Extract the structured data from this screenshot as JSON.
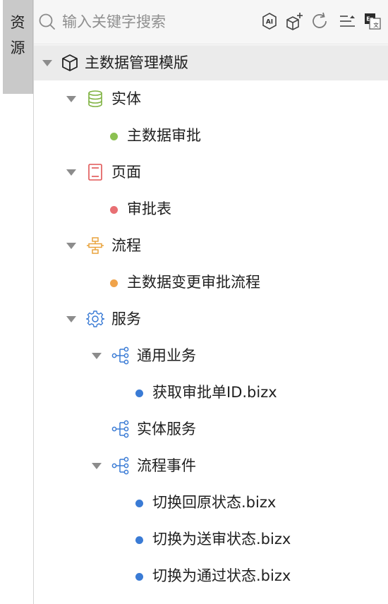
{
  "sidebar": {
    "tab_label_line1": "资",
    "tab_label_line2": "源"
  },
  "search": {
    "placeholder": "输入关键字搜索",
    "value": ""
  },
  "toolbar": {
    "ai_label": "AI",
    "lang_label_en": "En",
    "lang_label_zh": "文"
  },
  "tree": {
    "root": {
      "label": "主数据管理模版",
      "icon": "cube-icon"
    },
    "entity_group": {
      "label": "实体",
      "icon": "database-icon"
    },
    "entity_item": {
      "label": "主数据审批",
      "color": "#8cc152"
    },
    "page_group": {
      "label": "页面",
      "icon": "page-icon"
    },
    "page_item": {
      "label": "审批表",
      "color": "#e86f73"
    },
    "flow_group": {
      "label": "流程",
      "icon": "flow-icon"
    },
    "flow_item": {
      "label": "主数据变更审批流程",
      "color": "#f0a34a"
    },
    "service_group": {
      "label": "服务",
      "icon": "gear-icon"
    },
    "service_common": {
      "label": "通用业务",
      "icon": "hierarchy-icon"
    },
    "service_common_item": {
      "label": "获取审批单ID.bizx",
      "color": "#3a7bd5"
    },
    "service_entity": {
      "label": "实体服务",
      "icon": "hierarchy-icon"
    },
    "service_flow_events": {
      "label": "流程事件",
      "icon": "hierarchy-icon"
    },
    "service_flow_item_1": {
      "label": "切换回原状态.bizx",
      "color": "#3a7bd5"
    },
    "service_flow_item_2": {
      "label": "切换为送审状态.bizx",
      "color": "#3a7bd5"
    },
    "service_flow_item_3": {
      "label": "切换为通过状态.bizx",
      "color": "#3a7bd5"
    }
  }
}
